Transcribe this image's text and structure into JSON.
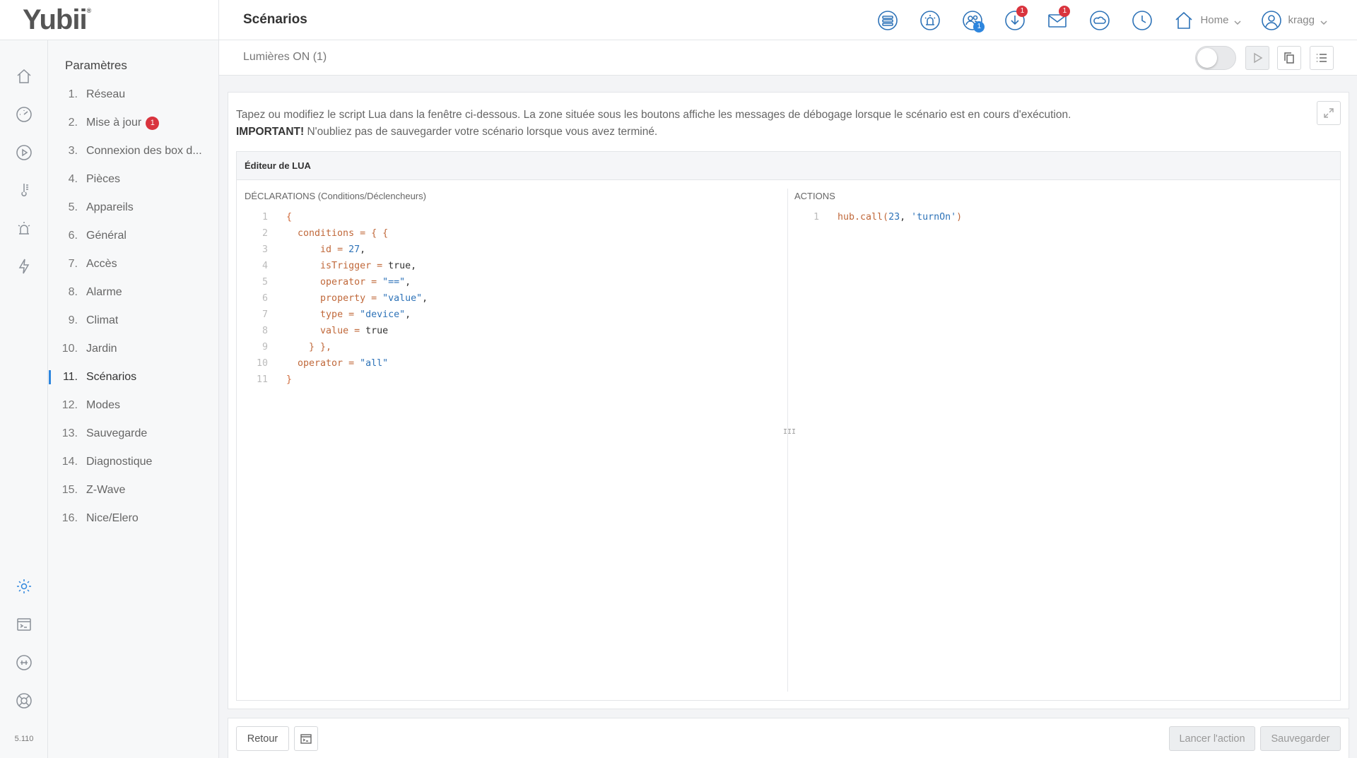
{
  "app": {
    "logo": "Yubii",
    "logo_mark": "®",
    "page_title": "Scénarios",
    "version": "5.110"
  },
  "topbar": {
    "icons": [
      {
        "name": "devices-icon"
      },
      {
        "name": "alarm-icon"
      },
      {
        "name": "users-icon",
        "badge": "1"
      },
      {
        "name": "download-icon",
        "badge": "1"
      },
      {
        "name": "mail-icon",
        "badge": "1"
      },
      {
        "name": "weather-icon"
      },
      {
        "name": "clock-icon"
      }
    ],
    "home_label": "Home",
    "user_label": "kragg"
  },
  "settings": {
    "title": "Paramètres",
    "items": [
      {
        "num": "1.",
        "label": "Réseau"
      },
      {
        "num": "2.",
        "label": "Mise à jour",
        "badge": "1"
      },
      {
        "num": "3.",
        "label": "Connexion des box d..."
      },
      {
        "num": "4.",
        "label": "Pièces"
      },
      {
        "num": "5.",
        "label": "Appareils"
      },
      {
        "num": "6.",
        "label": "Général"
      },
      {
        "num": "7.",
        "label": "Accès"
      },
      {
        "num": "8.",
        "label": "Alarme"
      },
      {
        "num": "9.",
        "label": "Climat"
      },
      {
        "num": "10.",
        "label": "Jardin"
      },
      {
        "num": "11.",
        "label": "Scénarios",
        "active": true
      },
      {
        "num": "12.",
        "label": "Modes"
      },
      {
        "num": "13.",
        "label": "Sauvegarde"
      },
      {
        "num": "14.",
        "label": "Diagnostique"
      },
      {
        "num": "15.",
        "label": "Z-Wave"
      },
      {
        "num": "16.",
        "label": "Nice/Elero"
      }
    ]
  },
  "subheader": {
    "scene_name": "Lumières ON (1)",
    "toggle_on": false
  },
  "panel": {
    "intro_text": "Tapez ou modifiez le script Lua dans la fenêtre ci-dessous. La zone située sous les boutons affiche les messages de débogage lorsque le scénario est en cours d'exécution.",
    "important_label": "IMPORTANT!",
    "important_text": " N'oubliez pas de sauvegarder votre scénario lorsque vous avez terminé.",
    "editor_title": "Éditeur de LUA",
    "declarations_label": "DÉCLARATIONS (Conditions/Déclencheurs)",
    "actions_label": "ACTIONS",
    "grip": "III"
  },
  "footer": {
    "back_label": "Retour",
    "run_label": "Lancer l'action",
    "save_label": "Sauvegarder"
  },
  "colors": {
    "accent": "#2e86de",
    "icon_blue": "#2e73b8",
    "badge_red": "#d9343e",
    "code_orange": "#c0683a"
  }
}
